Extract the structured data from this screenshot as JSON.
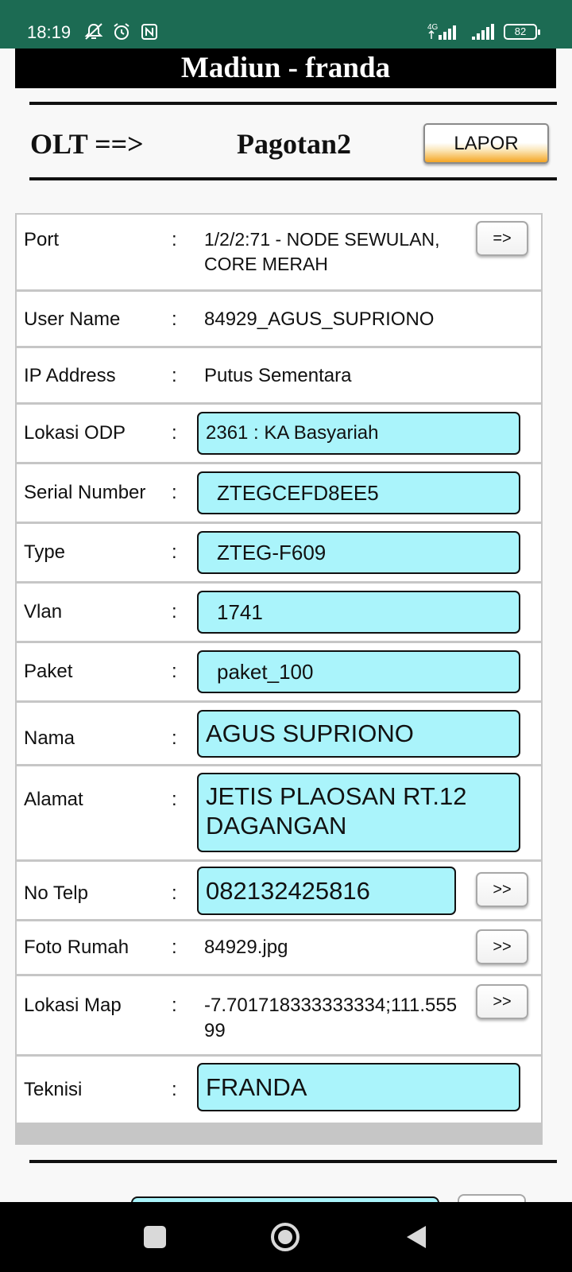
{
  "status_bar": {
    "time": "18:19",
    "network": "4G",
    "battery": "82",
    "icons": [
      "mute-notification-icon",
      "alarm-icon",
      "nfc-icon",
      "signal-4g-icon",
      "signal-icon",
      "battery-icon"
    ]
  },
  "header": {
    "title": "Madiun - franda",
    "olt_label": "OLT ==>",
    "olt_name": "Pagotan2",
    "lapor_button": "LAPOR"
  },
  "colon": ":",
  "rows": {
    "port": {
      "label": "Port",
      "value": "1/2/2:71 - NODE SEWULAN, CORE MERAH",
      "button": "=>"
    },
    "user_name": {
      "label": "User Name",
      "value": "84929_AGUS_SUPRIONO"
    },
    "ip_address": {
      "label": "IP Address",
      "value": "Putus Sementara"
    },
    "lokasi_odp": {
      "label": "Lokasi ODP",
      "value": "2361 : KA Basyariah"
    },
    "serial_number": {
      "label": "Serial Number",
      "value": "ZTEGCEFD8EE5"
    },
    "type": {
      "label": "Type",
      "value": "ZTEG-F609"
    },
    "vlan": {
      "label": "Vlan",
      "value": "1741"
    },
    "paket": {
      "label": "Paket",
      "value": "paket_100"
    },
    "nama": {
      "label": "Nama",
      "value": "AGUS SUPRIONO"
    },
    "alamat": {
      "label": "Alamat",
      "value": "JETIS PLAOSAN RT.12 DAGANGAN"
    },
    "no_telp": {
      "label": "No Telp",
      "value": "082132425816",
      "button": ">>"
    },
    "foto_rumah": {
      "label": "Foto Rumah",
      "value": "84929.jpg",
      "button": ">>"
    },
    "lokasi_map": {
      "label": "Lokasi Map",
      "value": "-7.701718333333334;111.55599",
      "button": ">>"
    },
    "teknisi": {
      "label": "Teknisi",
      "value": "FRANDA"
    }
  },
  "colors": {
    "status_bar": "#1c6b53",
    "field_bg": "#aaf4fb",
    "lapor_accent": "#f5a623"
  },
  "navigation": [
    "recents-square-icon",
    "home-circle-icon",
    "back-triangle-icon"
  ]
}
